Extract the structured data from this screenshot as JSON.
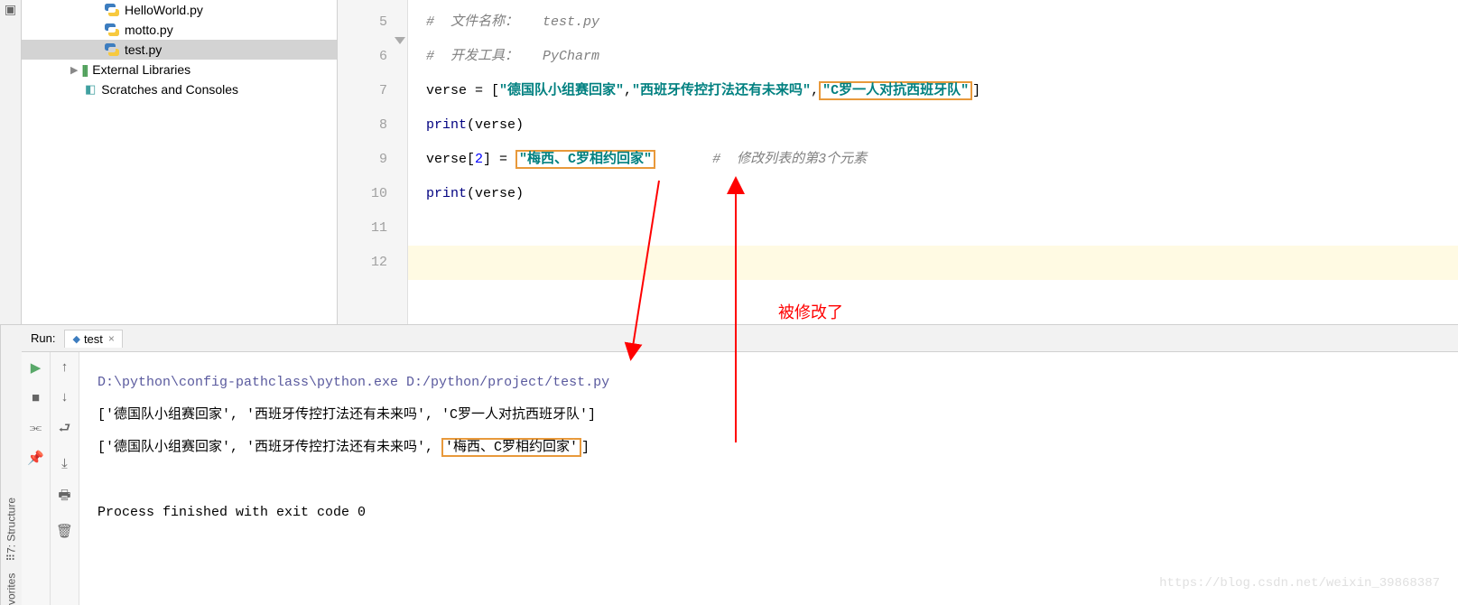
{
  "tree": {
    "files": [
      {
        "name": "HelloWorld.py"
      },
      {
        "name": "motto.py"
      },
      {
        "name": "test.py"
      }
    ],
    "lib": "External Libraries",
    "scratch": "Scratches and Consoles"
  },
  "gutter": [
    "5",
    "6",
    "7",
    "8",
    "9",
    "10",
    "11",
    "12"
  ],
  "code": {
    "l5_comment": "#  文件名称：   test.py",
    "l6_comment": "#  开发工具：   PyCharm",
    "l7": {
      "var": "verse = [",
      "s1": "\"德国队小组赛回家\"",
      "c1": ",",
      "s2": "\"西班牙传控打法还有未来吗\"",
      "c2": ",",
      "s3": "\"C罗一人对抗西班牙队\"",
      "end": "]"
    },
    "l8_print": "print",
    "l8_rest": "(verse)",
    "l9": {
      "pre": "verse[",
      "idx": "2",
      "mid": "] = ",
      "s": "\"梅西、C罗相约回家\"",
      "comment": "#  修改列表的第3个元素"
    },
    "l10_print": "print",
    "l10_rest": "(verse)"
  },
  "annotation": "被修改了",
  "run": {
    "label": "Run:",
    "tab": "test",
    "path": "D:\\python\\config-pathclass\\python.exe D:/python/project/test.py",
    "out1_a": "['德国队小组赛回家', '西班牙传控打法还有未来吗', '",
    "out1_b": "C罗一人对抗西班牙队",
    "out1_c": "']",
    "out2_a": "['德国队小组赛回家', '西班牙传控打法还有未来吗', ",
    "out2_b": "'梅西、C罗相约回家'",
    "out2_c": "]",
    "exit": "Process finished with exit code 0"
  },
  "side": {
    "structure": "7: Structure",
    "favorites": "vorites"
  },
  "watermark": "https://blog.csdn.net/weixin_39868387"
}
